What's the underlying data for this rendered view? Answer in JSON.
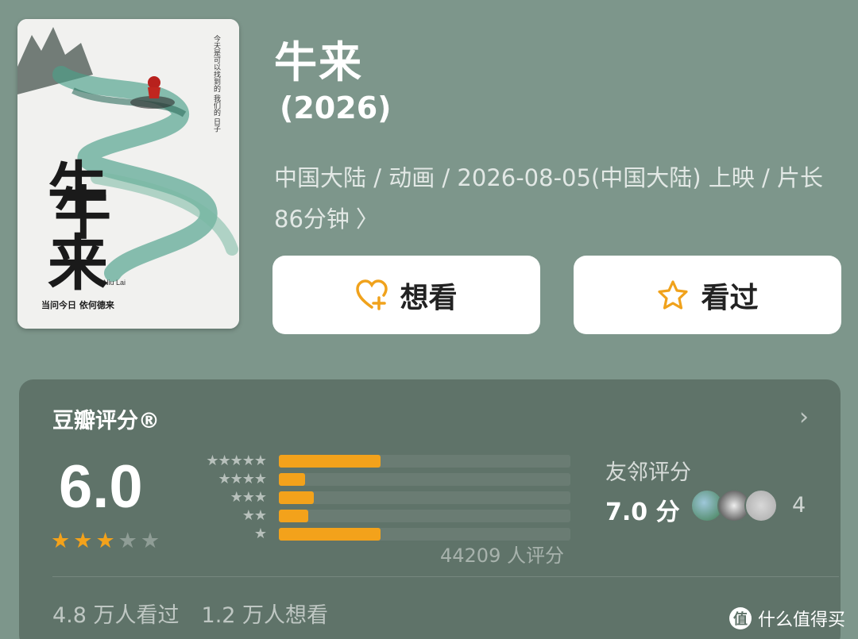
{
  "movie": {
    "title": "牛来",
    "year": "(2026)",
    "meta": "中国大陆 / 动画 / 2026-08-05(中国大陆) 上映 / 片长86分钟",
    "meta_chevron": "〉"
  },
  "poster": {
    "vertical_title": "牛来",
    "subtitle": "Niu Lai",
    "tagline": "当问今日  依何德来",
    "poem": "今天是可以找到的  我们的  日子"
  },
  "actions": {
    "want_label": "想看",
    "seen_label": "看过"
  },
  "rating": {
    "section_title": "豆瓣评分®",
    "score": "6.0",
    "stars_filled": 3,
    "stars_total": 5,
    "histogram": [
      {
        "stars": "★★★★★",
        "fraction": 0.35
      },
      {
        "stars": "★★★★",
        "fraction": 0.09
      },
      {
        "stars": "★★★",
        "fraction": 0.12
      },
      {
        "stars": "★★",
        "fraction": 0.1
      },
      {
        "stars": "★",
        "fraction": 0.35
      }
    ],
    "count_text": "44209 人评分",
    "more_arrow": "›"
  },
  "friends": {
    "label": "友邻评分",
    "score": "7.0 分",
    "count": "4"
  },
  "stats": {
    "seen": "4.8 万人看过",
    "want": "1.2 万人想看"
  },
  "watermark": {
    "badge": "值",
    "text": "什么值得买"
  },
  "colors": {
    "background": "#7d968b",
    "panel": "#5f7369",
    "accent": "#f3a21b"
  }
}
